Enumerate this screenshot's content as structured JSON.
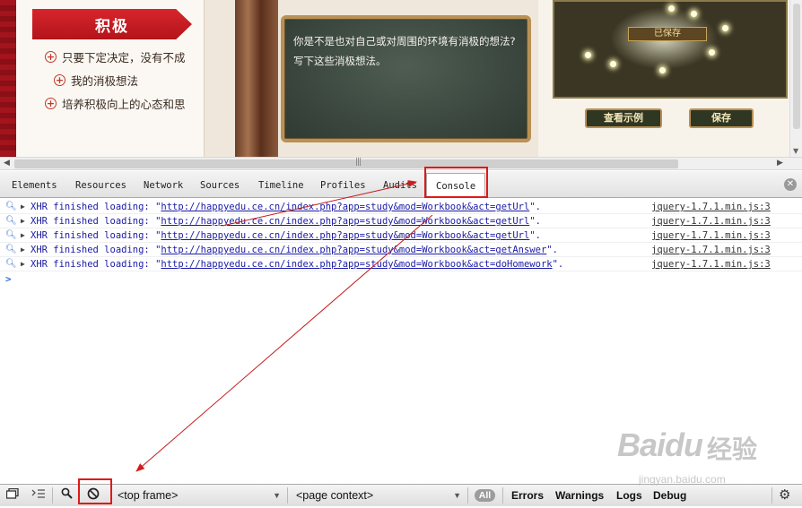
{
  "webpage": {
    "banner_title": "积极",
    "menu": [
      {
        "label": "只要下定决定，没有不成"
      },
      {
        "label": "我的消极想法"
      },
      {
        "label": "培养积极向上的心态和思"
      }
    ],
    "blackboard_line1": "你是不是也对自己或对周围的环境有消极的想法?",
    "blackboard_line2": "写下这些消极想法。",
    "saved_label": "已保存",
    "view_example_label": "查看示例",
    "save_label": "保存"
  },
  "devtools": {
    "tabs": [
      {
        "label": "Elements"
      },
      {
        "label": "Resources"
      },
      {
        "label": "Network"
      },
      {
        "label": "Sources"
      },
      {
        "label": "Timeline"
      },
      {
        "label": "Profiles"
      },
      {
        "label": "Audits"
      },
      {
        "label": "Console"
      }
    ],
    "active_tab": "Console",
    "console_rows": [
      {
        "prefix": "XHR finished loading: \"",
        "url": "http://happyedu.ce.cn/index.php?app=study&mod=Workbook&act=getUrl",
        "suffix": "\".",
        "source": "jquery-1.7.1.min.js:3"
      },
      {
        "prefix": "XHR finished loading: \"",
        "url": "http://happyedu.ce.cn/index.php?app=study&mod=Workbook&act=getUrl",
        "suffix": "\".",
        "source": "jquery-1.7.1.min.js:3"
      },
      {
        "prefix": "XHR finished loading: \"",
        "url": "http://happyedu.ce.cn/index.php?app=study&mod=Workbook&act=getUrl",
        "suffix": "\".",
        "source": "jquery-1.7.1.min.js:3"
      },
      {
        "prefix": "XHR finished loading: \"",
        "url": "http://happyedu.ce.cn/index.php?app=study&mod=Workbook&act=getAnswer",
        "suffix": "\".",
        "source": "jquery-1.7.1.min.js:3"
      },
      {
        "prefix": "XHR finished loading: \"",
        "url": "http://happyedu.ce.cn/index.php?app=study&mod=Workbook&act=doHomework",
        "suffix": "\".",
        "source": "jquery-1.7.1.min.js:3"
      }
    ],
    "prompt_symbol": ">",
    "statusbar": {
      "frame_select": "<top frame>",
      "context_select": "<page context>",
      "all_label": "All",
      "filters": [
        {
          "label": "Errors"
        },
        {
          "label": "Warnings"
        },
        {
          "label": "Logs"
        },
        {
          "label": "Debug"
        }
      ]
    }
  },
  "watermark": {
    "brand": "Baidu",
    "brand_cn": "经验",
    "url": "jingyan.baidu.com"
  },
  "colors": {
    "annotation_red": "#e01818",
    "console_link_blue": "#1a1aa6",
    "banner_red": "#d7252c"
  },
  "icons": [
    "dock-icon",
    "multiline-console-icon",
    "search-icon",
    "clear-console-icon",
    "gear-icon",
    "close-icon",
    "plus-circle-icon",
    "expand-triangle-icon",
    "magnifier-icon"
  ]
}
